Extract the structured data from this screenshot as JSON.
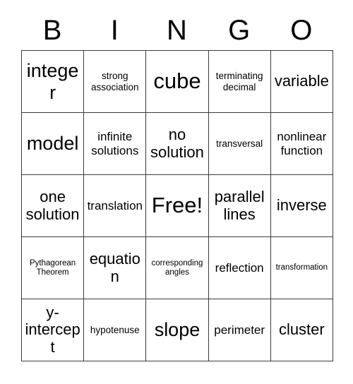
{
  "card": {
    "header": {
      "letters": [
        "B",
        "I",
        "N",
        "G",
        "O"
      ]
    },
    "rows": [
      [
        {
          "text": "integer",
          "size": "fs-lg"
        },
        {
          "text": "strong association",
          "size": "fs-xs"
        },
        {
          "text": "cube",
          "size": "fs-xl"
        },
        {
          "text": "terminating decimal",
          "size": "fs-xs"
        },
        {
          "text": "variable",
          "size": "fs-md"
        }
      ],
      [
        {
          "text": "model",
          "size": "fs-lg"
        },
        {
          "text": "infinite solutions",
          "size": "fs-sm"
        },
        {
          "text": "no solution",
          "size": "fs-md"
        },
        {
          "text": "transversal",
          "size": "fs-xs"
        },
        {
          "text": "nonlinear function",
          "size": "fs-sm"
        }
      ],
      [
        {
          "text": "one solution",
          "size": "fs-md"
        },
        {
          "text": "translation",
          "size": "fs-sm"
        },
        {
          "text": "Free!",
          "size": "fs-xl"
        },
        {
          "text": "parallel lines",
          "size": "fs-md"
        },
        {
          "text": "inverse",
          "size": "fs-md"
        }
      ],
      [
        {
          "text": "Pythagorean Theorem",
          "size": "fs-xxs"
        },
        {
          "text": "equation",
          "size": "fs-md"
        },
        {
          "text": "corresponding angles",
          "size": "fs-xxs"
        },
        {
          "text": "reflection",
          "size": "fs-sm"
        },
        {
          "text": "transformation",
          "size": "fs-xxs"
        }
      ],
      [
        {
          "text": "y-intercept",
          "size": "fs-md"
        },
        {
          "text": "hypotenuse",
          "size": "fs-xs"
        },
        {
          "text": "slope",
          "size": "fs-lg"
        },
        {
          "text": "perimeter",
          "size": "fs-sm"
        },
        {
          "text": "cluster",
          "size": "fs-md"
        }
      ]
    ]
  },
  "colors": {
    "grid_line": "#3b3b3b",
    "text": "#000000",
    "background": "#ffffff"
  }
}
